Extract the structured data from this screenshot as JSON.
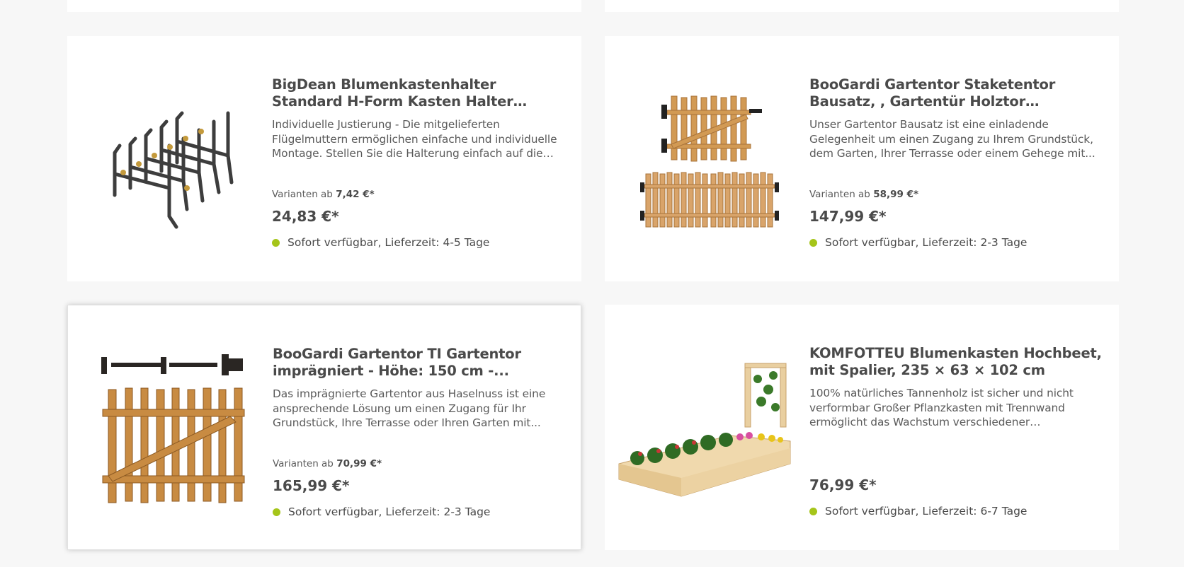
{
  "products": [
    {
      "title": "BigDean Blumenkastenhalter Standard H-Form Kasten Halter Balkonkastenhalter, ...",
      "description": "Individuelle Justierung - Die mitgelieferten Flügelmuttern ermöglichen einfache und individuelle Montage. Stellen Sie die Halterung einfach auf die von...",
      "variants_prefix": "Varianten ab",
      "variants_price": "7,42 €*",
      "price": "24,83 €*",
      "delivery": "Sofort verfügbar, Lieferzeit: 4-5 Tage",
      "image_icon": "flower-box-holder-image"
    },
    {
      "title": "BooGardi Gartentor Staketentor Bausatz, , Gartentür Holztor Staketenzaun Zauntor...",
      "description": "Unser Gartentor Bausatz ist eine einladende Gelegenheit um einen Zugang zu Ihrem Grundstück, dem Garten, Ihrer Terrasse oder einem Gehege mit...",
      "variants_prefix": "Varianten ab",
      "variants_price": "58,99 €*",
      "price": "147,99 €*",
      "delivery": "Sofort verfügbar, Lieferzeit: 2-3 Tage",
      "image_icon": "garden-gate-kit-image"
    },
    {
      "title": "BooGardi Gartentor TI Gartentor imprägniert - Höhe: 150 cm -...",
      "description": "Das imprägnierte Gartentor aus Haselnuss ist eine ansprechende Lösung um einen Zugang für Ihr Grundstück, Ihre Terrasse oder Ihren Garten mit...",
      "variants_prefix": "Varianten ab",
      "variants_price": "70,99 €*",
      "price": "165,99 €*",
      "delivery": "Sofort verfügbar, Lieferzeit: 2-3 Tage",
      "image_icon": "hazel-garden-gate-image"
    },
    {
      "title": "KOMFOTTEU Blumenkasten Hochbeet, mit Spalier, 235 × 63 × 102 cm",
      "description": "100% natürliches Tannenholz ist sicher und nicht verformbar Großer Pflanzkasten mit Trennwand ermöglicht das Wachstum verschiedener Pflanzenarte...",
      "price": "76,99 €*",
      "delivery": "Sofort verfügbar, Lieferzeit: 6-7 Tage",
      "image_icon": "raised-bed-planter-image"
    }
  ],
  "colors": {
    "availability_dot": "#a5c51a",
    "page_background": "#f7f7f7",
    "card_background": "#ffffff"
  }
}
